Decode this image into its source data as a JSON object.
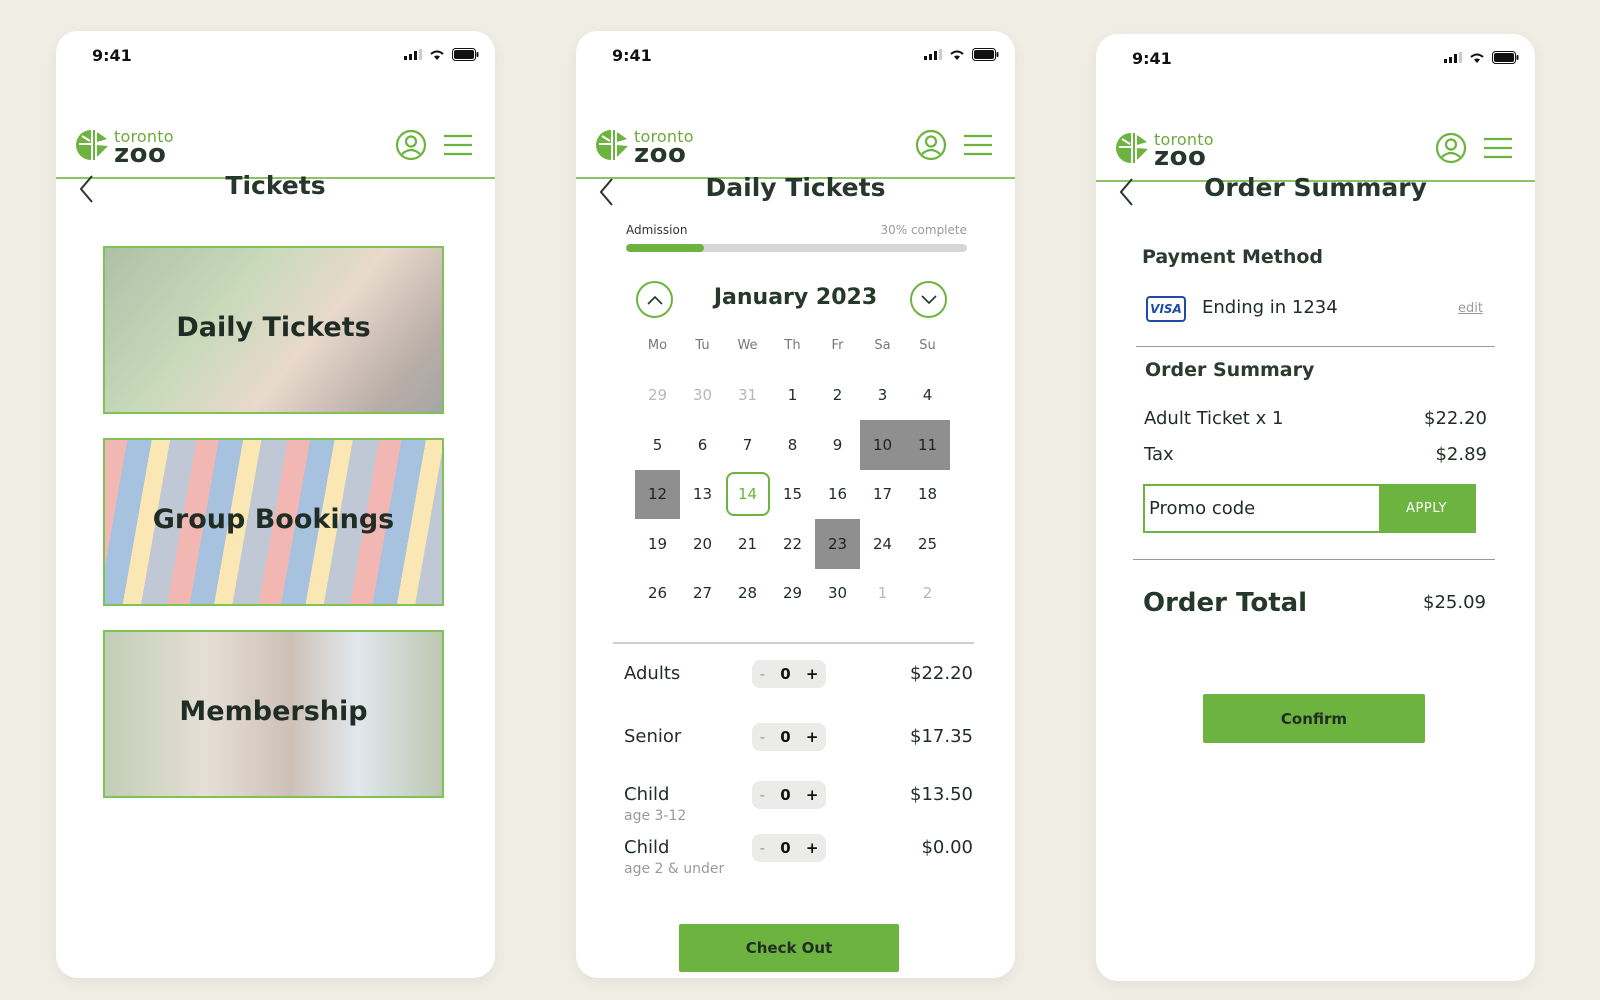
{
  "brand": {
    "line1": "toronto",
    "line2": "zoo"
  },
  "status": {
    "time": "9:41"
  },
  "screen1": {
    "title": "Tickets",
    "tiles": [
      "Daily Tickets",
      "Group Bookings",
      "Membership"
    ]
  },
  "screen2": {
    "title": "Daily Tickets",
    "progress_label": "Admission",
    "progress_text": "30% complete",
    "progress_value": 0.23,
    "month": "January 2023",
    "weekdays": [
      "Mo",
      "Tu",
      "We",
      "Th",
      "Fr",
      "Sa",
      "Su"
    ],
    "days": [
      {
        "d": "29",
        "s": "muted"
      },
      {
        "d": "30",
        "s": "muted"
      },
      {
        "d": "31",
        "s": "muted"
      },
      {
        "d": "1"
      },
      {
        "d": "2"
      },
      {
        "d": "3"
      },
      {
        "d": "4"
      },
      {
        "d": "5"
      },
      {
        "d": "6"
      },
      {
        "d": "7"
      },
      {
        "d": "8"
      },
      {
        "d": "9"
      },
      {
        "d": "10",
        "s": "unavail"
      },
      {
        "d": "11",
        "s": "unavail"
      },
      {
        "d": "12",
        "s": "unavail"
      },
      {
        "d": "13"
      },
      {
        "d": "14",
        "s": "sel"
      },
      {
        "d": "15"
      },
      {
        "d": "16"
      },
      {
        "d": "17"
      },
      {
        "d": "18"
      },
      {
        "d": "19"
      },
      {
        "d": "20"
      },
      {
        "d": "21"
      },
      {
        "d": "22"
      },
      {
        "d": "23",
        "s": "unavail"
      },
      {
        "d": "24"
      },
      {
        "d": "25"
      },
      {
        "d": "26"
      },
      {
        "d": "27"
      },
      {
        "d": "28"
      },
      {
        "d": "29"
      },
      {
        "d": "30"
      },
      {
        "d": "1",
        "s": "muted"
      },
      {
        "d": "2",
        "s": "muted"
      }
    ],
    "tickets": [
      {
        "name": "Adults",
        "sub": "",
        "qty": "0",
        "price": "$22.20"
      },
      {
        "name": "Senior",
        "sub": "",
        "qty": "0",
        "price": "$17.35"
      },
      {
        "name": "Child",
        "sub": "age 3-12",
        "qty": "0",
        "price": "$13.50"
      },
      {
        "name": "Child",
        "sub": "age 2 & under",
        "qty": "0",
        "price": "$0.00"
      }
    ],
    "stepper_minus": "-",
    "stepper_plus": "+",
    "checkout": "Check Out"
  },
  "screen3": {
    "title": "Order Summary",
    "payment_heading": "Payment Method",
    "card_brand": "VISA",
    "card_text": "Ending in 1234",
    "edit": "edit",
    "summary_heading": "Order Summary",
    "lines": [
      {
        "label": "Adult Ticket x 1",
        "value": "$22.20"
      },
      {
        "label": "Tax",
        "value": "$2.89"
      }
    ],
    "promo_placeholder": "Promo code",
    "apply": "APPLY",
    "total_label": "Order Total",
    "total_value": "$25.09",
    "confirm": "Confirm"
  },
  "colors": {
    "accent": "#6db33f",
    "ink": "#26372b",
    "bg": "#f0eee4"
  }
}
